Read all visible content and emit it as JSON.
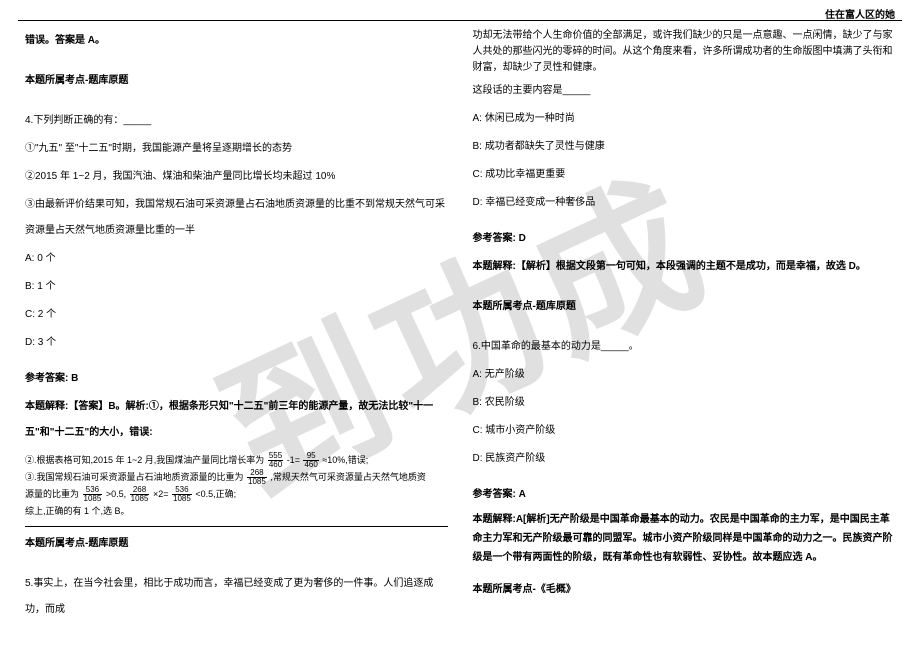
{
  "header": {
    "title": "住在富人区的她"
  },
  "watermark": "到功成",
  "left": {
    "p1": "错误。答案是 A。",
    "p2_bold": "本题所属考点-题库原题",
    "q4_stem": "4.下列判断正确的有：_____",
    "q4_s1": "①\"九五\" 至\"十二五\"时期，我国能源产量将呈逐期增长的态势",
    "q4_s2": "②2015 年 1~2 月，我国汽油、煤油和柴油产量同比增长均未超过 10%",
    "q4_s3": "③由最新评价结果可知，我国常规石油可采资源量占石油地质资源量的比重不到常规天然气可采资源量占天然气地质资源量比重的一半",
    "q4_a": "A: 0 个",
    "q4_b": "B: 1 个",
    "q4_c": "C: 2 个",
    "q4_d": "D: 3 个",
    "q4_ans_label": "参考答案: B",
    "q4_exp": "本题解释:【答案】B。解析:①，根据条形只知\"十二五\"前三年的能源产量，故无法比较\"十一五\"和\"十二五\"的大小，错误:",
    "math_l1a": "②.根据表格可知,2015 年 1~2 月,我国煤油产量同比增长率为",
    "math_l1b": "≈10%,错误;",
    "frac1_num": "555",
    "frac1_den": "460",
    "frac_minus": "-1=",
    "frac2_num": "95",
    "frac2_den": "460",
    "math_l2a": "③.我国常规石油可采资源量占石油地质资源量的比重为",
    "frac3_num": "268",
    "frac3_den": "1085",
    "math_l2b": ",常规天然气可采资源量占天然气地质资",
    "math_l3a": "源量的比重为",
    "frac4_num": "536",
    "frac4_den": "1085",
    "math_l3b": ">0.5,",
    "frac5_num": "268",
    "frac5_den": "1085",
    "math_l3c": "×2=",
    "frac6_num": "536",
    "frac6_den": "1085",
    "math_l3d": "<0.5,正确;",
    "math_l4": "综上,正确的有 1 个,选 B。",
    "p3_bold": "本题所属考点-题库原题",
    "q5_stem": "5.事实上，在当今社会里，相比于成功而言，幸福已经变成了更为奢侈的一件事。人们追逐成功，而成"
  },
  "right": {
    "p1": "功却无法带给个人生命价值的全部满足，或许我们缺少的只是一点意趣、一点闲情，缺少了与家人共处的那些闪光的零碎的时间。从这个角度来看，许多所谓成功者的生命版图中填满了头衔和财富，却缺少了灵性和健康。",
    "p2": "这段话的主要内容是_____",
    "q5_a": "A: 休闲已成为一种时尚",
    "q5_b": "B: 成功者都缺失了灵性与健康",
    "q5_c": "C: 成功比幸福更重要",
    "q5_d": "D: 幸福已经变成一种奢侈品",
    "q5_ans_label": "参考答案: D",
    "q5_exp": "本题解释:【解析】根据文段第一句可知，本段强调的主题不是成功，而是幸福，故选 D。",
    "p3_bold": "本题所属考点-题库原题",
    "q6_stem": "6.中国革命的最基本的动力是_____。",
    "q6_a": "A: 无产阶级",
    "q6_b": "B: 农民阶级",
    "q6_c": "C: 城市小资产阶级",
    "q6_d": "D: 民族资产阶级",
    "q6_ans_label": "参考答案: A",
    "q6_exp": "本题解释:A[解析]无产阶级是中国革命最基本的动力。农民是中国革命的主力军，是中国民主革命主力军和无产阶级最可靠的同盟军。城市小资产阶级同样是中国革命的动力之一。民族资产阶级是一个带有两面性的阶级，既有革命性也有软弱性、妥协性。故本题应选 A。",
    "p4_bold": "本题所属考点-《毛概》"
  }
}
